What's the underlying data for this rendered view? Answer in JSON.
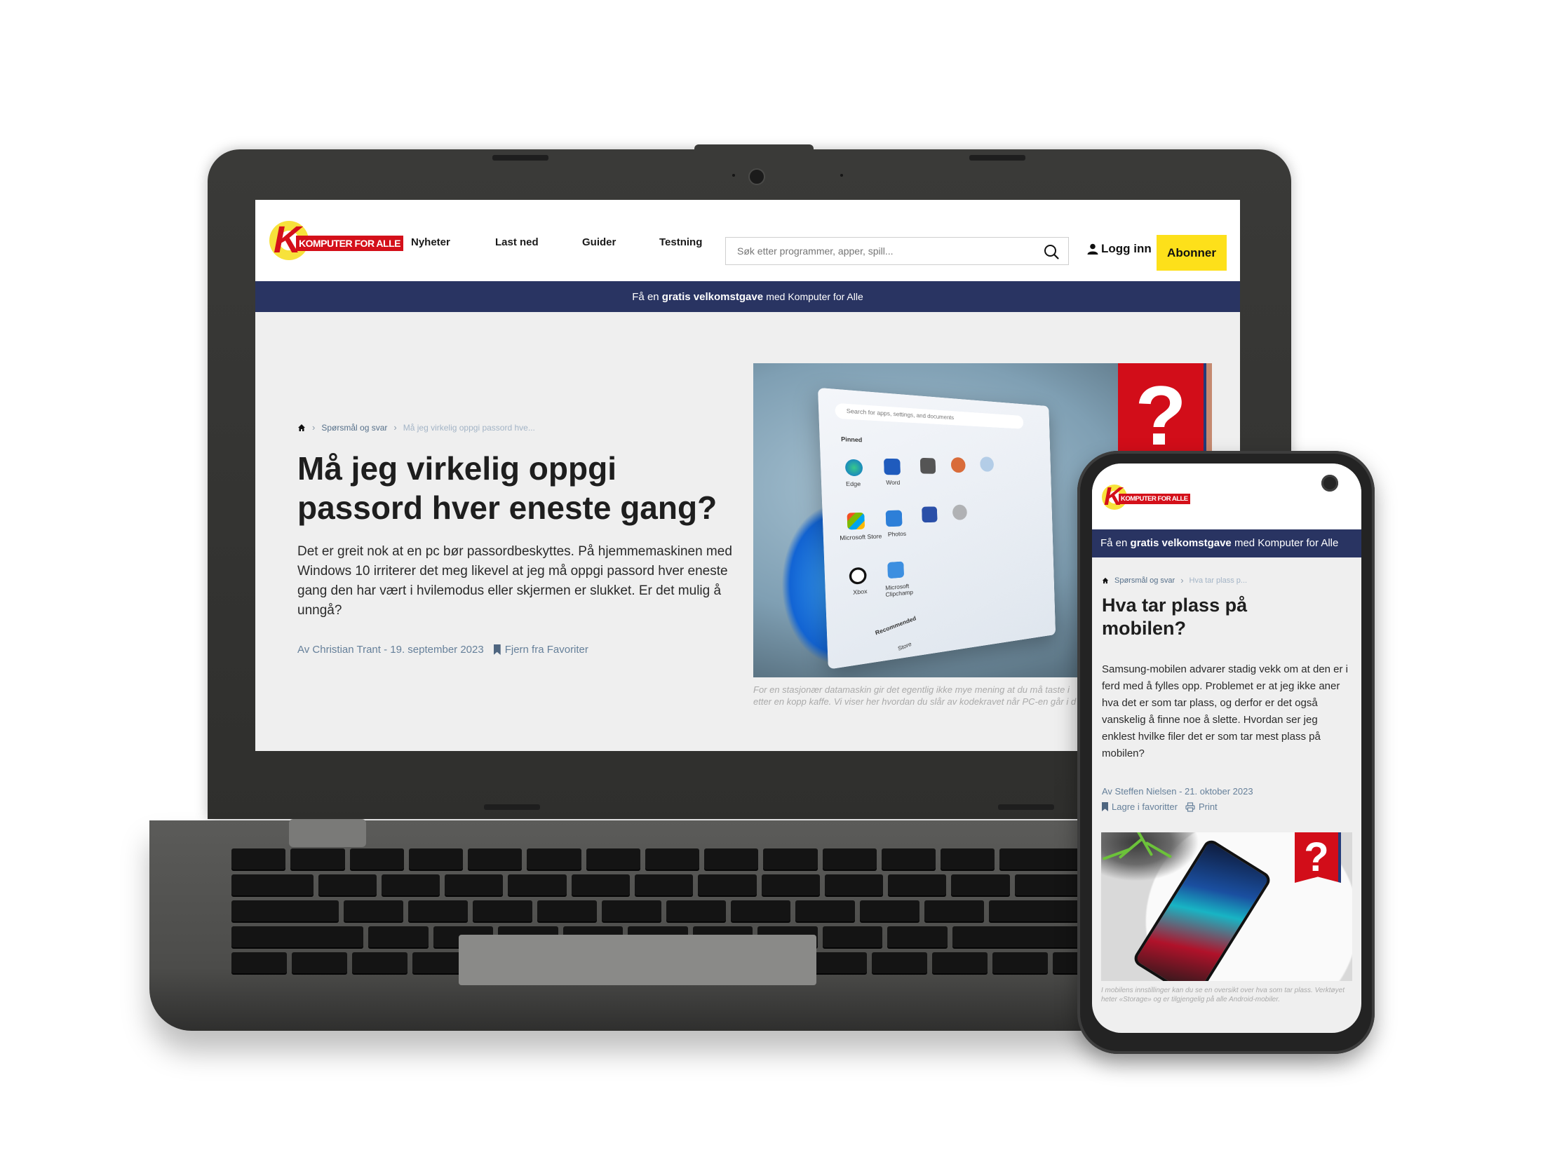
{
  "site": {
    "logo_text": "KOMPUTER FOR ALLE",
    "logo_letter": "K",
    "nav": [
      "Nyheter",
      "Last ned",
      "Guider",
      "Testning"
    ],
    "search": {
      "placeholder": "Søk etter programmer, apper, spill...",
      "value": "",
      "icon": "search-icon"
    },
    "login_label": "Logg inn",
    "subscribe_label": "Abonner",
    "banner": {
      "prefix": "Få en",
      "bold": "gratis velkomstgave",
      "suffix": "med Komputer for Alle"
    },
    "colors": {
      "banner": "#293462",
      "subscribe": "#fde01a",
      "brand_red": "#d4101a",
      "meta": "#66809a"
    }
  },
  "laptop": {
    "breadcrumb": {
      "home_icon": "home-icon",
      "section": "Spørsmål og svar",
      "current": "Må jeg virkelig oppgi passord hve..."
    },
    "title": "Må jeg virkelig oppgi passord hver eneste gang?",
    "lede": "Det er greit nok at en pc bør passordbeskyttes. På hjemmemaskinen med Windows 10 irriterer det meg likevel at jeg må oppgi passord hver eneste gang den har vært i hvilemodus eller skjermen er slukket. Er det mulig å unngå?",
    "byline": "Av Christian Trant - 19. september 2023",
    "favorite_label": "Fjern fra Favoriter",
    "hero": {
      "badge": "?",
      "start_menu": {
        "search": "Search for apps, settings, and documents",
        "pinned_label": "Pinned",
        "recommended_label": "Recommended",
        "apps": [
          "Edge",
          "Word",
          "Microsoft Store",
          "Photos",
          "Xbox",
          "Microsoft Clipchamp",
          "Store"
        ]
      }
    },
    "caption_lines": [
      "For en stasjonær datamaskin gir det egentlig ikke mye mening at du må taste i",
      "etter en kopp kaffe. Vi viser her hvordan du slår av kodekravet når PC-en går i d"
    ]
  },
  "phone": {
    "breadcrumb": {
      "home_icon": "home-icon",
      "section": "Spørsmål og svar",
      "current": "Hva tar plass p..."
    },
    "title": "Hva tar plass på mobilen?",
    "lede": "Samsung-mobilen advarer stadig vekk om at den er i ferd med å fylles opp. Problemet er at jeg ikke aner hva det er som tar plass, og derfor er det også vanskelig å finne noe å slette. Hvordan ser jeg enklest hvilke filer det er som tar mest plass på mobilen?",
    "byline": "Av Steffen Nielsen - 21. oktober 2023",
    "favorite_label": "Lagre i favoritter",
    "print_label": "Print",
    "hero": {
      "badge": "?"
    },
    "caption": "I mobilens innstillinger kan du se en oversikt over hva som tar plass. Verktøyet heter «Storage» og er tilgjengelig på alle Android-mobiler."
  }
}
